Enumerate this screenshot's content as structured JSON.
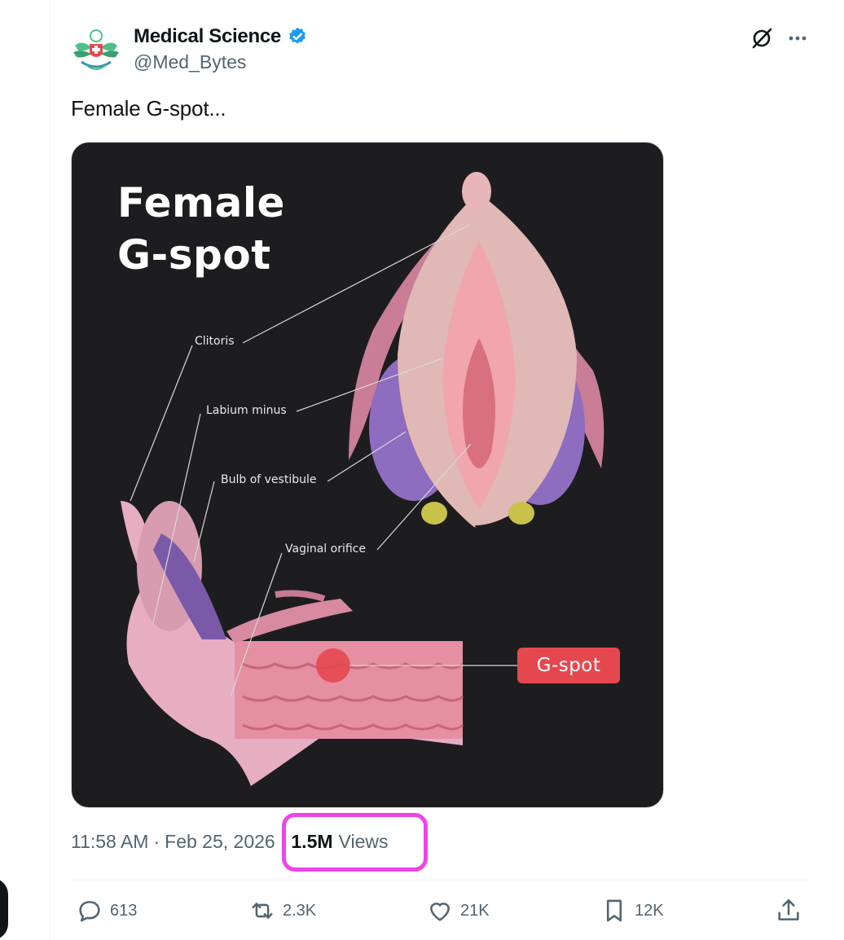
{
  "author": {
    "name": "Medical Science",
    "handle": "@Med_Bytes",
    "verified": true,
    "avatar_icon": "medical-caduceus-wings-logo"
  },
  "header_icons": {
    "grok": "grok-icon",
    "more": "more-horizontal-icon"
  },
  "post": {
    "text": "Female G-spot..."
  },
  "image": {
    "title_line1": "Female",
    "title_line2": "G-spot",
    "labels": {
      "clitoris": "Clitoris",
      "labium_minus": "Labium minus",
      "bulb_of_vestibule": "Bulb of vestibule",
      "vaginal_orifice": "Vaginal orifice",
      "g_spot": "G-spot"
    },
    "background_color": "#1d1d20",
    "badge_color": "#e5484f"
  },
  "meta": {
    "time": "11:58 AM",
    "separator": "·",
    "date": "Feb 25, 2026",
    "views_count": "1.5M",
    "views_label": "Views",
    "highlight_color": "#ee44e8"
  },
  "actions": {
    "replies": "613",
    "reposts": "2.3K",
    "likes": "21K",
    "bookmarks": "12K",
    "reply_icon": "reply-icon",
    "repost_icon": "repost-icon",
    "like_icon": "heart-icon",
    "bookmark_icon": "bookmark-icon",
    "share_icon": "share-icon"
  }
}
